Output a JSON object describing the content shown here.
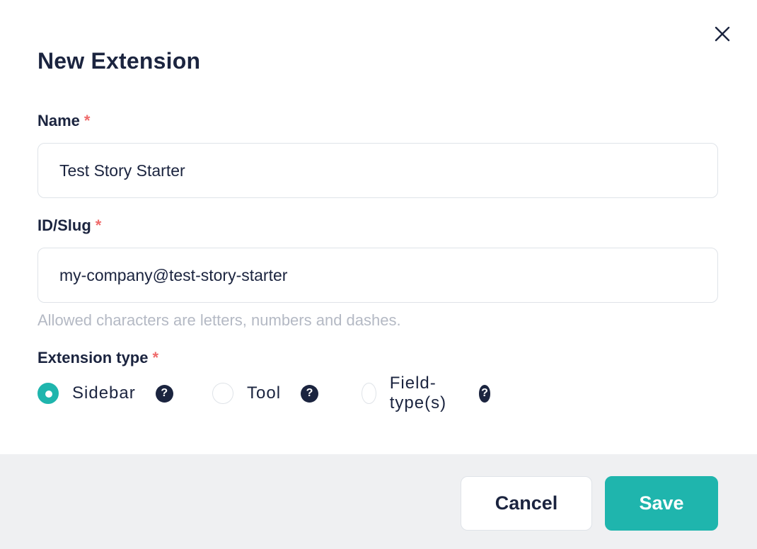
{
  "dialog": {
    "title": "New Extension",
    "close_icon": "close-icon"
  },
  "form": {
    "name": {
      "label": "Name",
      "required_mark": "*",
      "value": "Test Story Starter"
    },
    "slug": {
      "label": "ID/Slug",
      "required_mark": "*",
      "value": "my-company@test-story-starter",
      "hint": "Allowed characters are letters, numbers and dashes."
    },
    "extension_type": {
      "label": "Extension type",
      "required_mark": "*",
      "options": [
        {
          "label": "Sidebar",
          "selected": true,
          "help_glyph": "?"
        },
        {
          "label": "Tool",
          "selected": false,
          "help_glyph": "?"
        },
        {
          "label": "Field-type(s)",
          "selected": false,
          "help_glyph": "?"
        }
      ]
    }
  },
  "footer": {
    "cancel_label": "Cancel",
    "save_label": "Save"
  },
  "colors": {
    "accent": "#1fb5ad",
    "text": "#1b243f",
    "required": "#ef6b6b",
    "hint": "#b4b9c4",
    "footer_bg": "#eff0f2"
  }
}
